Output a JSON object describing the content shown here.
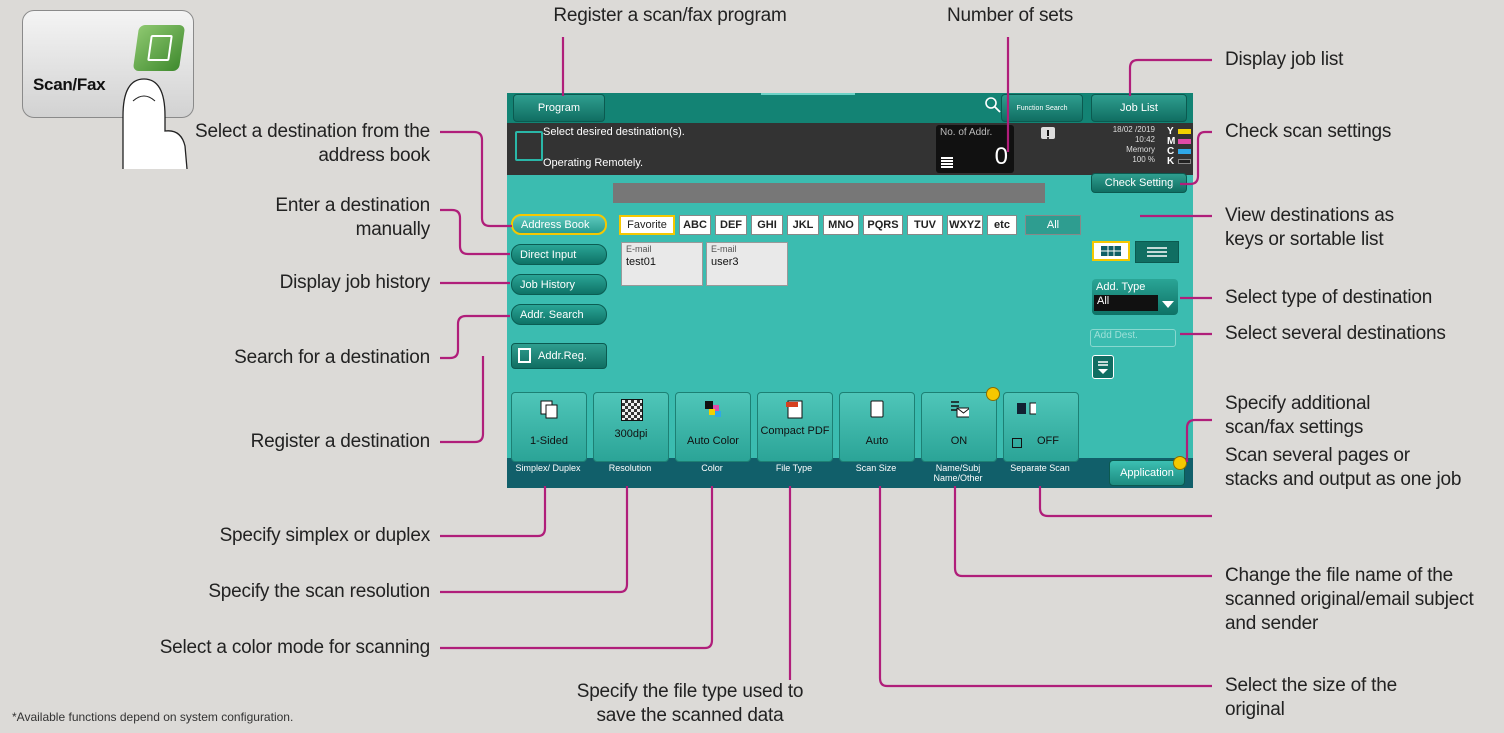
{
  "hardware_key": {
    "label": "Scan/Fax"
  },
  "screen": {
    "top_bar": {
      "program": "Program",
      "function_search": "Function Search",
      "job_list": "Job List"
    },
    "message": {
      "line1": "Select desired destination(s).",
      "line2": "Operating Remotely."
    },
    "counter": {
      "label": "No. of Addr.",
      "value": "0"
    },
    "status": {
      "date": "18/02 /2019",
      "time": "10:42",
      "memory_label": "Memory",
      "memory_value": "100 %",
      "toner": [
        {
          "letter": "Y",
          "color": "#f2d100"
        },
        {
          "letter": "M",
          "color": "#e04aa8"
        },
        {
          "letter": "C",
          "color": "#2fa8e8"
        },
        {
          "letter": "K",
          "color": "#222222"
        }
      ]
    },
    "check_setting": "Check Setting",
    "side_buttons": [
      "Address Book",
      "Direct Input",
      "Job History",
      "Addr. Search"
    ],
    "addr_reg": "Addr.Reg.",
    "index_tabs": [
      "Favorite",
      "ABC",
      "DEF",
      "GHI",
      "JKL",
      "MNO",
      "PQRS",
      "TUV",
      "WXYZ",
      "etc",
      "All"
    ],
    "destinations": [
      {
        "type": "E-mail",
        "name": "test01"
      },
      {
        "type": "E-mail",
        "name": "user3"
      }
    ],
    "add_type": {
      "label": "Add. Type",
      "value": "All"
    },
    "add_dest": "Add Dest.",
    "functions": [
      {
        "value": "1-Sided",
        "label": "Simplex/\nDuplex"
      },
      {
        "value": "300dpi",
        "label": "Resolution"
      },
      {
        "value": "Auto Color",
        "label": "Color"
      },
      {
        "value": "Compact PDF",
        "label": "File Type"
      },
      {
        "value": "Auto",
        "label": "Scan Size"
      },
      {
        "value": "ON",
        "label": "Name/Subj Name/Other"
      },
      {
        "value": "OFF",
        "label": "Separate Scan"
      }
    ],
    "application": "Application"
  },
  "callouts": {
    "register_program": "Register a scan/fax program",
    "number_of_sets": "Number of sets",
    "display_job_list": "Display job list",
    "check_scan_settings": "Check scan settings",
    "view_destinations": "View destinations as keys or sortable list",
    "select_type": "Select type of destination",
    "select_several": "Select several destinations",
    "additional_settings": "Specify additional scan/fax settings",
    "scan_several": "Scan several pages or stacks and output as one job",
    "change_file_name": "Change the file name of the scanned original/email subject and sender",
    "select_size": "Select the size of the original",
    "file_type": "Specify the file type used to save the scanned data",
    "color_mode": "Select a color mode for scanning",
    "resolution": "Specify the scan resolution",
    "simplex_duplex": "Specify simplex or duplex",
    "register_destination": "Register a destination",
    "search_destination": "Search for a destination",
    "job_history": "Display job history",
    "enter_manually": "Enter a destination manually",
    "address_book": "Select a destination from the address book"
  },
  "footnote": "*Available functions depend on system configuration."
}
